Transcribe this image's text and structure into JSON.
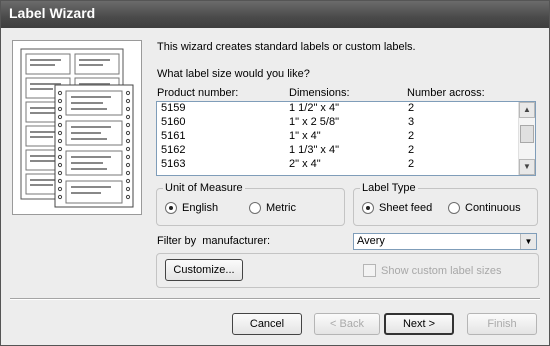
{
  "window": {
    "title": "Label Wizard"
  },
  "intro_text": "This wizard creates standard labels or custom labels.",
  "question_text": "What label size would you like?",
  "columns": {
    "product": "Product number:",
    "dimensions": "Dimensions:",
    "across": "Number across:"
  },
  "rows": [
    {
      "product": "5159",
      "dimensions": "1 1/2\" x 4\"",
      "across": "2"
    },
    {
      "product": "5160",
      "dimensions": "1\" x 2 5/8\"",
      "across": "3"
    },
    {
      "product": "5161",
      "dimensions": "1\" x 4\"",
      "across": "2"
    },
    {
      "product": "5162",
      "dimensions": "1 1/3\" x 4\"",
      "across": "2"
    },
    {
      "product": "5163",
      "dimensions": "2\" x 4\"",
      "across": "2"
    }
  ],
  "unit_group": {
    "label": "Unit of Measure",
    "english": "English",
    "metric": "Metric",
    "selected": "English"
  },
  "label_type_group": {
    "label": "Label Type",
    "sheet": "Sheet feed",
    "continuous": "Continuous",
    "selected": "Sheet feed"
  },
  "filter": {
    "label": "Filter by  manufacturer:",
    "value": "Avery"
  },
  "customize_button": "Customize...",
  "custom_sizes_checkbox": "Show custom label sizes",
  "buttons": {
    "cancel": "Cancel",
    "back": "< Back",
    "next": "Next >",
    "finish": "Finish"
  },
  "icons": {
    "scroll_up": "scroll-up-arrow",
    "scroll_down": "scroll-down-arrow",
    "dropdown": "dropdown-arrow"
  }
}
